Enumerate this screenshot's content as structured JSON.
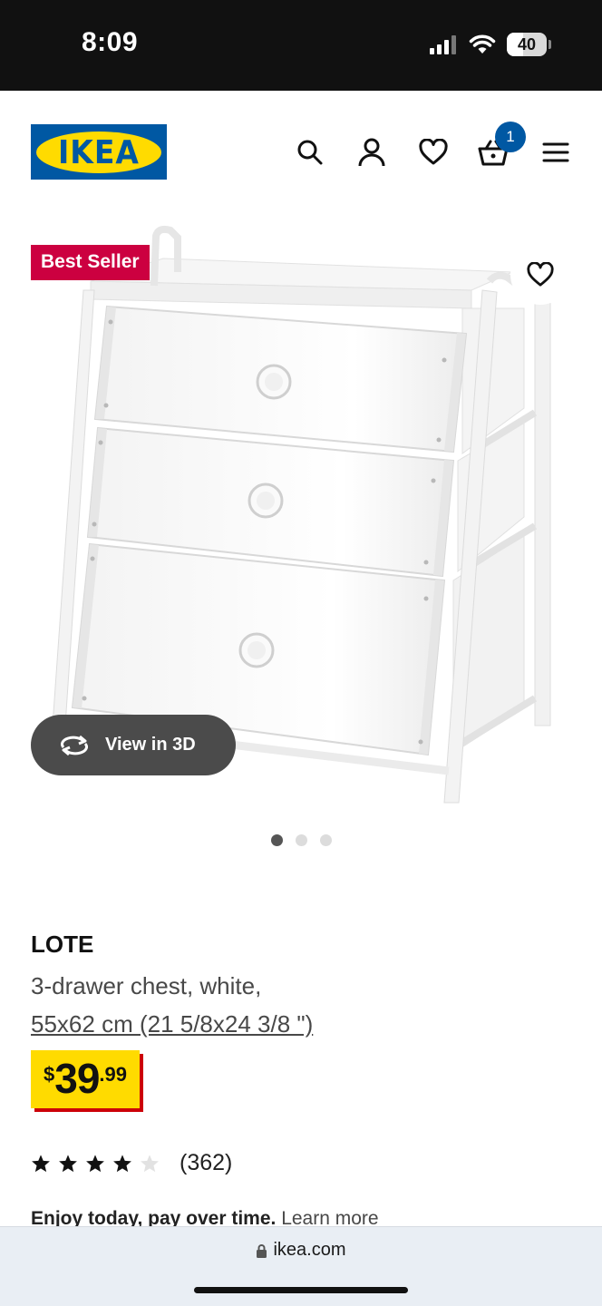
{
  "status_bar": {
    "time": "8:09",
    "battery": "40",
    "battery_level": 0.4
  },
  "header": {
    "logo_text": "IKEA",
    "icons": [
      "search-icon",
      "user-icon",
      "heart-icon",
      "cart-icon",
      "menu-icon"
    ],
    "cart_count": "1"
  },
  "product": {
    "badge": "Best Seller",
    "view_3d_label": "View in 3D",
    "image_count": 3,
    "active_image": 1,
    "name": "LOTE",
    "description": "3-drawer chest, white,",
    "size": "55x62 cm (21 5/8x24 3/8 \")",
    "price": {
      "currency": "$",
      "integer": "39",
      "decimal": ".99"
    },
    "rating": {
      "value": 4,
      "max": 5,
      "count": "(362)"
    },
    "financing": {
      "text": "Enjoy today, pay over time.",
      "link": "Learn more"
    }
  },
  "browser": {
    "url": "ikea.com"
  },
  "colors": {
    "ikea_blue": "#0058a3",
    "ikea_yellow": "#ffdb00",
    "badge_red": "#cc0040",
    "price_shadow_red": "#cc0008"
  }
}
